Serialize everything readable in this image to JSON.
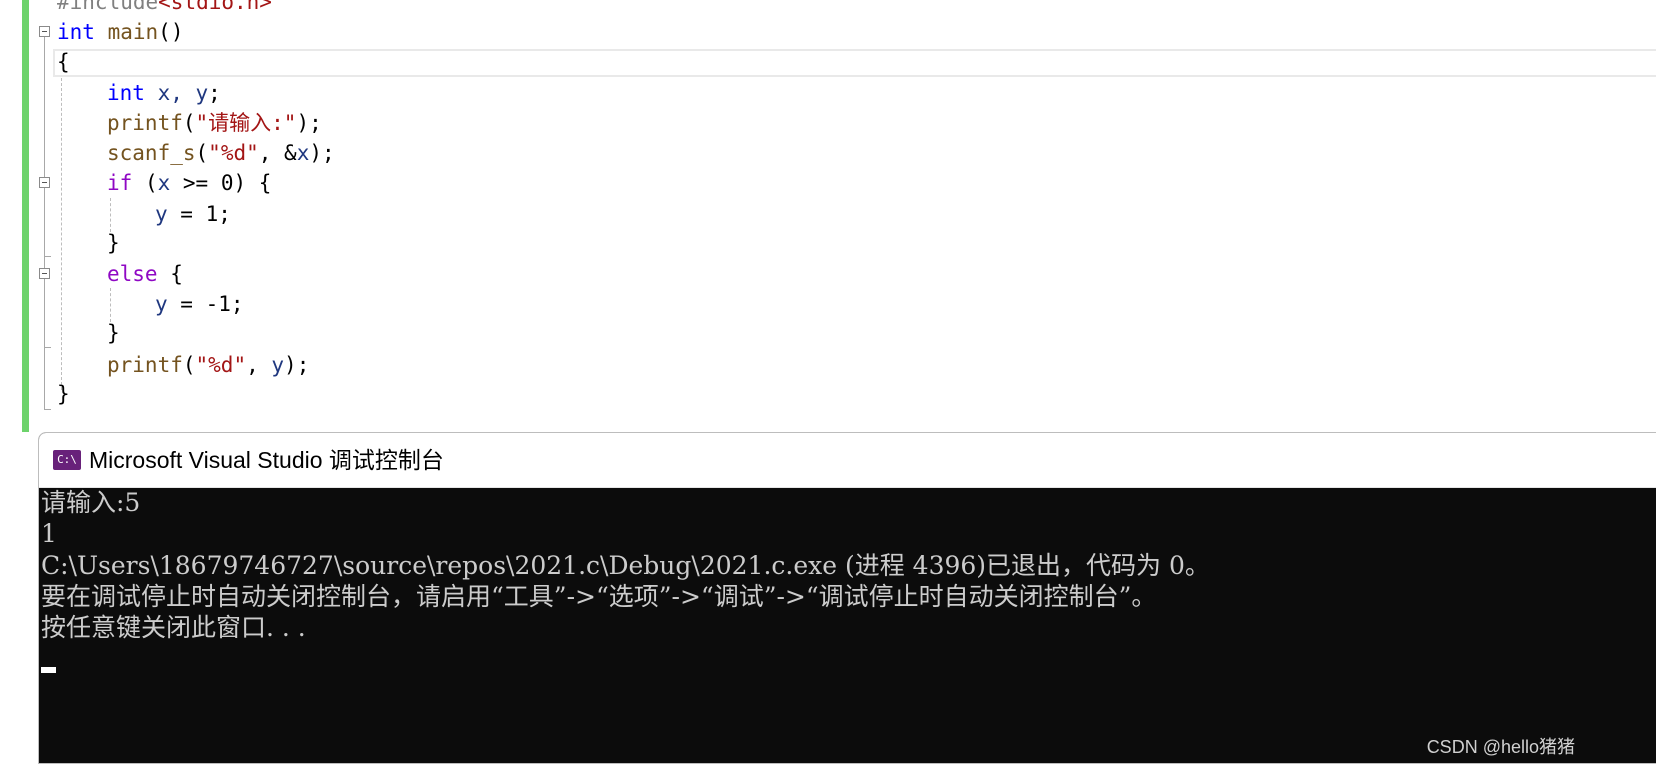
{
  "editor": {
    "lines": {
      "include": {
        "directive": "#include",
        "header": "<stdio.h>"
      },
      "main_decl": {
        "type": "int",
        "name": "main",
        "parens": "()"
      },
      "open_brace": "{",
      "decl": {
        "type": "int",
        "vars": "x, y",
        "semi": ";"
      },
      "printf1": {
        "fn": "printf",
        "open": "(",
        "str": "\"请输入:\"",
        "close": ");"
      },
      "scanf": {
        "fn": "scanf_s",
        "open": "(",
        "str": "\"%d\"",
        "rest": ", &",
        "var": "x",
        "close": ");"
      },
      "if_line": {
        "kw": "if",
        "open": " (",
        "var": "x",
        "rest": " >= 0) {"
      },
      "assign1": {
        "var": "y",
        "rest": " = 1;"
      },
      "close_if": "}",
      "else_line": {
        "kw": "else",
        "rest": " {"
      },
      "assign2": {
        "var": "y",
        "rest": " = -1;"
      },
      "close_else": "}",
      "printf2": {
        "fn": "printf",
        "open": "(",
        "str": "\"%d\"",
        "rest": ", ",
        "var": "y",
        "close": ");"
      },
      "close_main": "}"
    }
  },
  "console": {
    "icon_text": "C:\\",
    "title": "Microsoft Visual Studio 调试控制台",
    "output": [
      "请输入:5",
      "1",
      "C:\\Users\\18679746727\\source\\repos\\2021.c\\Debug\\2021.c.exe (进程 4396)已退出，代码为 0。",
      "要在调试停止时自动关闭控制台，请启用“工具”->“选项”->“调试”->“调试停止时自动关闭控制台”。",
      "按任意键关闭此窗口. . ."
    ]
  },
  "watermark": "CSDN @hello猪猪"
}
